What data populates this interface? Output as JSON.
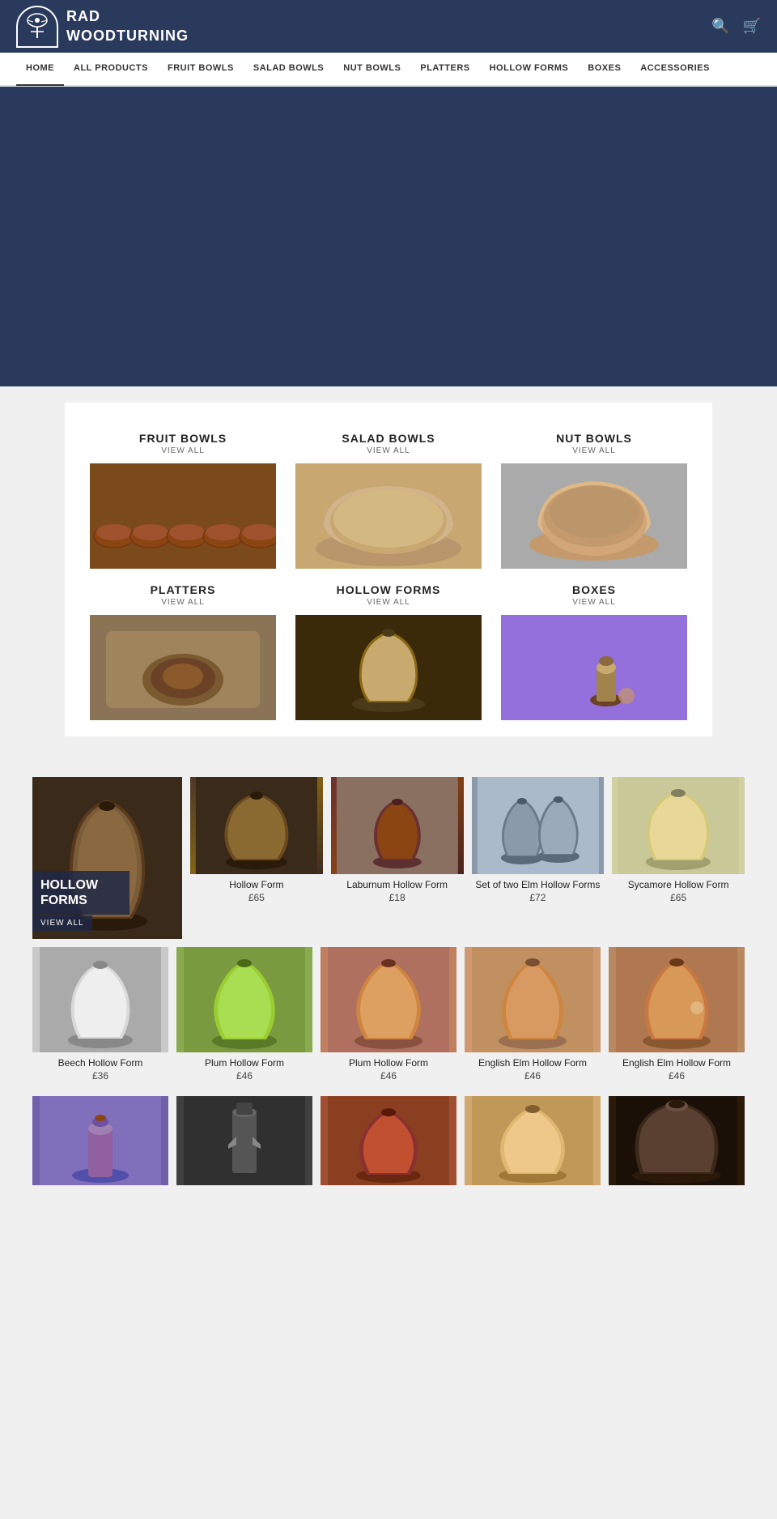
{
  "header": {
    "logo_line1": "RAD",
    "logo_line2": "WOODTURNING",
    "search_label": "🔍",
    "cart_label": "🛒"
  },
  "nav": {
    "items": [
      {
        "label": "HOME",
        "active": true
      },
      {
        "label": "ALL PRODUCTS",
        "active": false
      },
      {
        "label": "FRUIT BOWLS",
        "active": false
      },
      {
        "label": "SALAD BOWLS",
        "active": false
      },
      {
        "label": "NUT BOWLS",
        "active": false
      },
      {
        "label": "PLATTERS",
        "active": false
      },
      {
        "label": "HOLLOW FORMS",
        "active": false
      },
      {
        "label": "BOXES",
        "active": false
      },
      {
        "label": "ACCESSORIES",
        "active": false
      }
    ]
  },
  "categories": [
    {
      "title": "FRUIT BOWLS",
      "viewall": "VIEW ALL",
      "img_class": "cat-img-fruit"
    },
    {
      "title": "SALAD BOWLS",
      "viewall": "VIEW ALL",
      "img_class": "cat-img-salad"
    },
    {
      "title": "NUT BOWLS",
      "viewall": "VIEW ALL",
      "img_class": "cat-img-nut"
    },
    {
      "title": "PLATTERS",
      "viewall": "VIEW ALL",
      "img_class": "cat-img-platters"
    },
    {
      "title": "HOLLOW FORMS",
      "viewall": "VIEW ALL",
      "img_class": "cat-img-hollow"
    },
    {
      "title": "BOXES",
      "viewall": "VIEW ALL",
      "img_class": "cat-img-boxes"
    }
  ],
  "hollow_section": {
    "hero_title": "HOLLOW\nFORMS",
    "hero_viewall": "VIEW ALL"
  },
  "products_row1": [
    {
      "name": "Hollow Form",
      "price": "£65",
      "img_class": "p-img-1"
    },
    {
      "name": "Laburnum Hollow Form",
      "price": "£18",
      "img_class": "p-img-2"
    },
    {
      "name": "Set of two Elm Hollow Forms",
      "price": "£72",
      "img_class": "p-img-4"
    },
    {
      "name": "Sycamore Hollow Form",
      "price": "£65",
      "img_class": "p-img-5"
    }
  ],
  "products_row2": [
    {
      "name": "Beech Hollow Form",
      "price": "£36",
      "img_class": "p-img-6"
    },
    {
      "name": "Plum Hollow Form",
      "price": "£46",
      "img_class": "p-img-7"
    },
    {
      "name": "Plum Hollow Form",
      "price": "£46",
      "img_class": "p-img-8"
    },
    {
      "name": "English Elm Hollow Form",
      "price": "£46",
      "img_class": "p-img-9"
    },
    {
      "name": "English Elm Hollow Form",
      "price": "£46",
      "img_class": "p-img-10"
    }
  ],
  "products_row3": [
    {
      "name": "",
      "price": "",
      "img_class": "p-img-b1"
    },
    {
      "name": "",
      "price": "",
      "img_class": "p-img-b2"
    },
    {
      "name": "",
      "price": "",
      "img_class": "p-img-b3"
    },
    {
      "name": "",
      "price": "",
      "img_class": "p-img-b4"
    },
    {
      "name": "",
      "price": "",
      "img_class": "p-img-b5"
    }
  ]
}
